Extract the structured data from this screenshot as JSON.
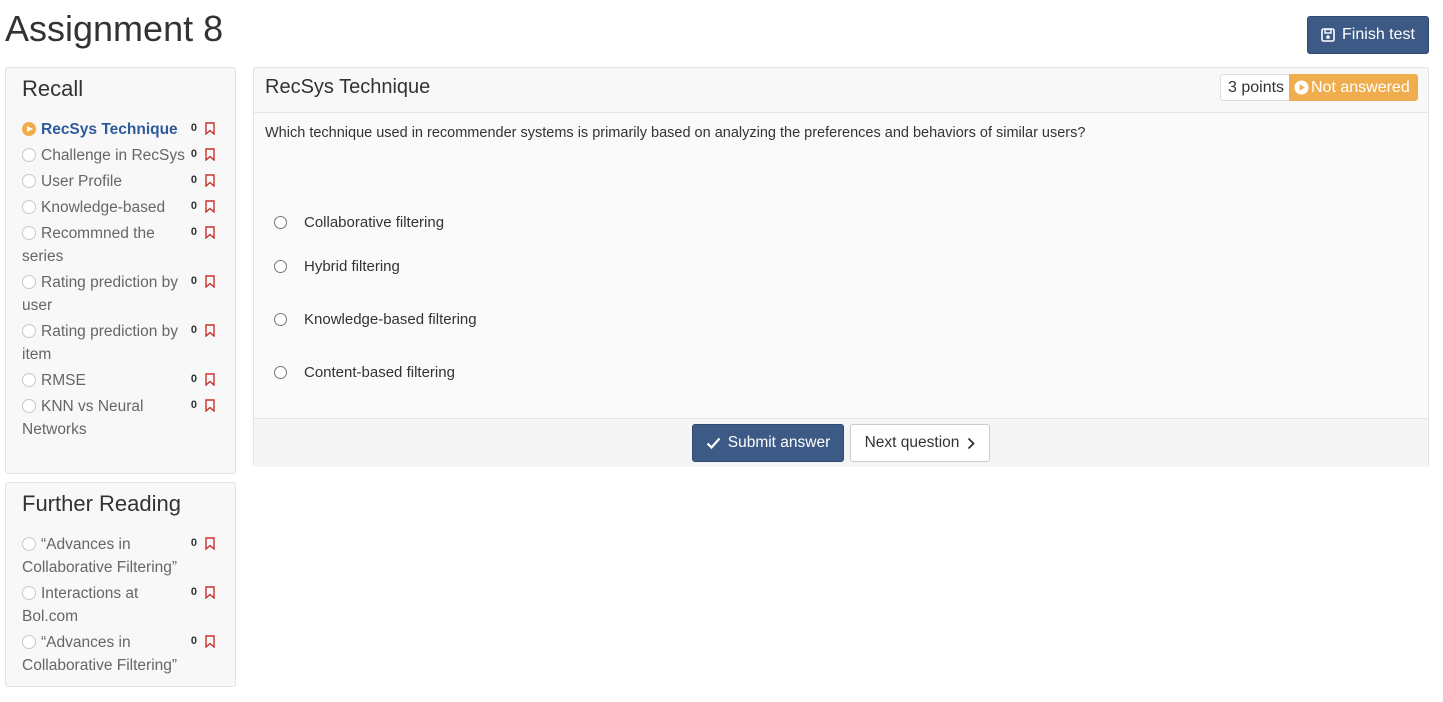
{
  "page": {
    "title": "Assignment 8"
  },
  "toolbar": {
    "finish_label": "Finish test"
  },
  "recall": {
    "heading": "Recall",
    "items": [
      {
        "label": "RecSys Technique",
        "count": "0"
      },
      {
        "label": "Challenge in RecSys",
        "count": "0"
      },
      {
        "label": "User Profile",
        "count": "0"
      },
      {
        "label": "Knowledge-based",
        "count": "0"
      },
      {
        "label": "Recommned the series",
        "count": "0"
      },
      {
        "label": "Rating prediction by user",
        "count": "0"
      },
      {
        "label": "Rating prediction by item",
        "count": "0"
      },
      {
        "label": "RMSE",
        "count": "0"
      },
      {
        "label": "KNN vs Neural Networks",
        "count": "0"
      }
    ]
  },
  "further_reading": {
    "heading": "Further Reading",
    "items": [
      {
        "label": "“Advances in Collaborative Filtering”",
        "count": "0"
      },
      {
        "label": "Interactions at Bol.com",
        "count": "0"
      },
      {
        "label": "“Advances in Collaborative Filtering”",
        "count": "0"
      }
    ]
  },
  "question": {
    "title": "RecSys Technique",
    "points": "3 points",
    "status": "Not answered",
    "text": "Which technique used in recommender systems is primarily based on analyzing the preferences and behaviors of similar users?",
    "options": [
      "Collaborative filtering",
      "Hybrid filtering",
      "Knowledge-based filtering",
      "Content-based filtering"
    ],
    "submit_label": "Submit answer",
    "next_label": "Next question"
  },
  "colors": {
    "primary": "#3c5a85",
    "warning": "#f0ad4e",
    "bookmark": "#c9302c",
    "active_link": "#2e5b9a"
  },
  "icons": {
    "finish": "floppy-disk-icon",
    "status": "play-circle-icon",
    "submit": "check-icon",
    "next": "chevron-right-icon",
    "bookmark": "bookmark-icon"
  }
}
